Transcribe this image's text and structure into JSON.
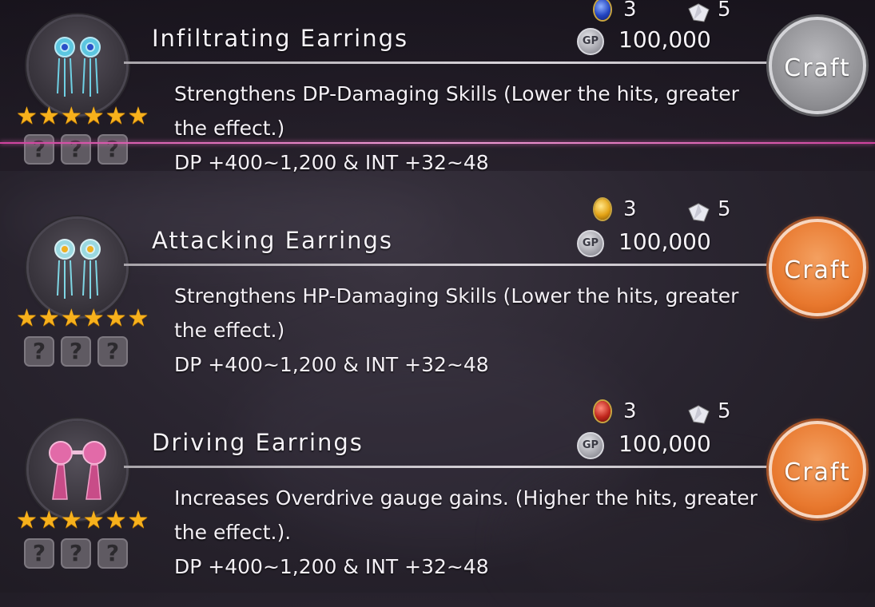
{
  "recipes": [
    {
      "name": "Infiltrating Earrings",
      "desc_line1": "Strengthens DP-Damaging Skills (Lower the hits, greater",
      "desc_line2": "the effect.)",
      "stats": "DP +400~1,200 & INT +32~48",
      "gem_count": "3",
      "gem_color": "blue",
      "crystal_count": "5",
      "gp_cost": "100,000",
      "craft_label": "Craft",
      "craft_state": "disabled",
      "stars": 6,
      "slots": [
        "?",
        "?",
        "?"
      ],
      "selected": true
    },
    {
      "name": "Attacking Earrings",
      "desc_line1": "Strengthens HP-Damaging Skills (Lower the hits, greater",
      "desc_line2": "the effect.)",
      "stats": "DP +400~1,200 & INT +32~48",
      "gem_count": "3",
      "gem_color": "gold",
      "crystal_count": "5",
      "gp_cost": "100,000",
      "craft_label": "Craft",
      "craft_state": "enabled",
      "stars": 6,
      "slots": [
        "?",
        "?",
        "?"
      ],
      "selected": false
    },
    {
      "name": "Driving Earrings",
      "desc_line1": "Increases Overdrive gauge gains. (Higher the hits, greater",
      "desc_line2": "the effect.).",
      "stats": "DP +400~1,200 & INT +32~48",
      "gem_count": "3",
      "gem_color": "red",
      "crystal_count": "5",
      "gp_cost": "100,000",
      "craft_label": "Craft",
      "craft_state": "enabled",
      "stars": 6,
      "slots": [
        "?",
        "?",
        "?"
      ],
      "selected": false
    }
  ],
  "gp_icon_text": "GP",
  "star_glyph": "★",
  "colors": {
    "accent_pink": "#d0429e",
    "craft_orange": "#e8782e",
    "craft_gray": "#8c8c90",
    "star_gold": "#f7b11c"
  }
}
